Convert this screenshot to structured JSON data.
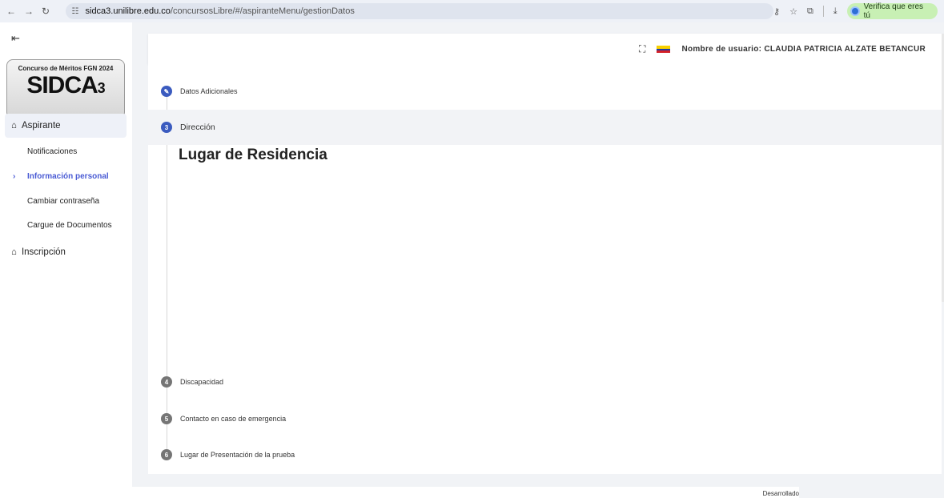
{
  "browser": {
    "url_host": "sidca3.unilibre.edu.co",
    "url_path": "/concursosLibre/#/aspiranteMenu/gestionDatos",
    "verify_label": "Verifica que eres tú"
  },
  "sidebar": {
    "logo_top": "Concurso de Méritos FGN 2024",
    "logo_brand": "SIDCA",
    "logo_num": "3",
    "sections": [
      {
        "label": "Aspirante",
        "icon": "home-icon"
      },
      {
        "label": "Inscripción",
        "icon": "home-icon"
      }
    ],
    "items": [
      {
        "label": "Notificaciones"
      },
      {
        "label": "Información personal"
      },
      {
        "label": "Cambiar contraseña"
      },
      {
        "label": "Cargue de Documentos"
      }
    ]
  },
  "header": {
    "user_label": "Nombre de usuario: CLAUDIA PATRICIA ALZATE BETANCUR"
  },
  "steps": [
    {
      "number": "✎",
      "label": "Datos Adicionales",
      "state": "done"
    },
    {
      "number": "3",
      "label": "Dirección",
      "state": "active"
    },
    {
      "number": "4",
      "label": "Discapacidad",
      "state": "pending"
    },
    {
      "number": "5",
      "label": "Contacto en caso de emergencia",
      "state": "pending"
    },
    {
      "number": "6",
      "label": "Lugar de Presentación de la prueba",
      "state": "pending"
    }
  ],
  "section": {
    "title": "Lugar de Residencia"
  },
  "footer": {
    "text": "Desarrollado"
  },
  "colors": {
    "accent": "#4a5bd4",
    "step_badge": "#3b5bbf",
    "pending_badge": "#757575"
  }
}
